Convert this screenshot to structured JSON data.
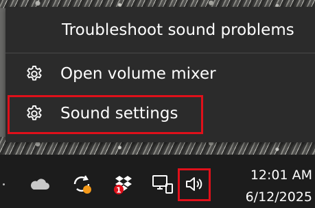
{
  "context_menu": {
    "items": [
      {
        "label": "Troubleshoot sound problems",
        "icon": null
      },
      {
        "label": "Open volume mixer",
        "icon": "gear-icon"
      },
      {
        "label": "Sound settings",
        "icon": "gear-icon"
      }
    ]
  },
  "taskbar": {
    "tray_icons": [
      "onedrive-cloud-icon",
      "sync-update-icon",
      "dropbox-icon",
      "network-icon",
      "speaker-volume-icon"
    ],
    "dropbox_badge": "1",
    "clock": {
      "time": "12:01 AM",
      "date": "6/12/2025"
    }
  },
  "colors": {
    "menu_background": "#2b2b2b",
    "taskbar_background": "#1c1c1c",
    "highlight_border": "#e0101a",
    "sync_badge": "#f59a1a",
    "dropbox_badge": "#e0101a"
  }
}
